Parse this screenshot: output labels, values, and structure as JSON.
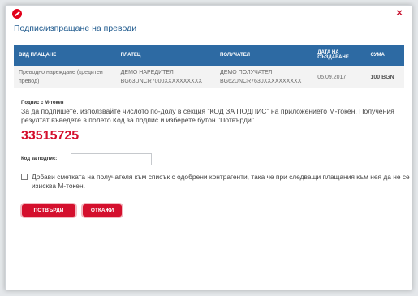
{
  "dialog": {
    "title": "Подпис/изпращане на преводи",
    "close": "×"
  },
  "table": {
    "headers": [
      "ВИД ПЛАЩАНЕ",
      "ПЛАТЕЦ",
      "ПОЛУЧАТЕЛ",
      "ДАТА НА СЪЗДАВАНЕ",
      "СУМА"
    ],
    "row": {
      "type_line1": "Преводно нареждане (кредитен",
      "type_line2": "превод)",
      "payer_name": "ДЕМО НАРЕДИТЕЛ",
      "payer_iban": "BG63UNCR7000XXXXXXXXXX",
      "payee_name": "ДЕМО ПОЛУЧАТЕЛ",
      "payee_iban": "BG62UNCR7630XXXXXXXXXX",
      "date": "05.09.2017",
      "amount": "100 BGN"
    }
  },
  "signing": {
    "heading": "Подпис с М-токен",
    "instruction": "За да подпишете, използвайте числото по-долу в секция \"КОД ЗА ПОДПИС\" на приложението М-токен. Получения резултат въведете в полето Код за подпис и изберете бутон \"Потвърди\".",
    "code": "33515725",
    "code_label": "Код за подпис:",
    "code_value": "",
    "checkbox_label": "Добави сметката на получателя към списък с одобрени контрагенти, така че при следващи плащания към нея да не се изисква М-токен."
  },
  "buttons": {
    "confirm": "ПОТВЪРДИ",
    "cancel": "ОТКАЖИ"
  },
  "colors": {
    "accent": "#d40f2d",
    "header_blue": "#2d6aa3"
  }
}
